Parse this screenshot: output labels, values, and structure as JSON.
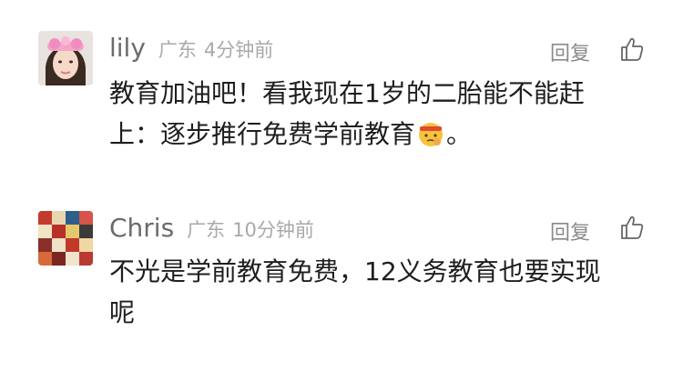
{
  "comments": [
    {
      "username": "lily",
      "location": "广东",
      "time": "4分钟前",
      "reply_label": "回复",
      "avatar": "photo-avatar-pink-headband",
      "content_line1": "教育加油吧！看我现在1岁的二胎能不能赶",
      "content_line2_before_emoji": "上：逐步推行免费学前教育",
      "emoji": "thinking-face-with-headband-emoji",
      "content_line2_after_emoji": "。",
      "like_icon": "thumbs-up-icon"
    },
    {
      "username": "Chris",
      "location": "广东",
      "time": "10分钟前",
      "reply_label": "回复",
      "avatar": "photo-avatar-colorful-grid",
      "content_line1": "不光是学前教育免费，12义务教育也要实现",
      "content_line2": "呢",
      "like_icon": "thumbs-up-icon"
    }
  ],
  "colors": {
    "username": "#6b6b6b",
    "meta": "#a9a9a9",
    "reply": "#8a8a8a",
    "content": "#1e1e1e"
  }
}
